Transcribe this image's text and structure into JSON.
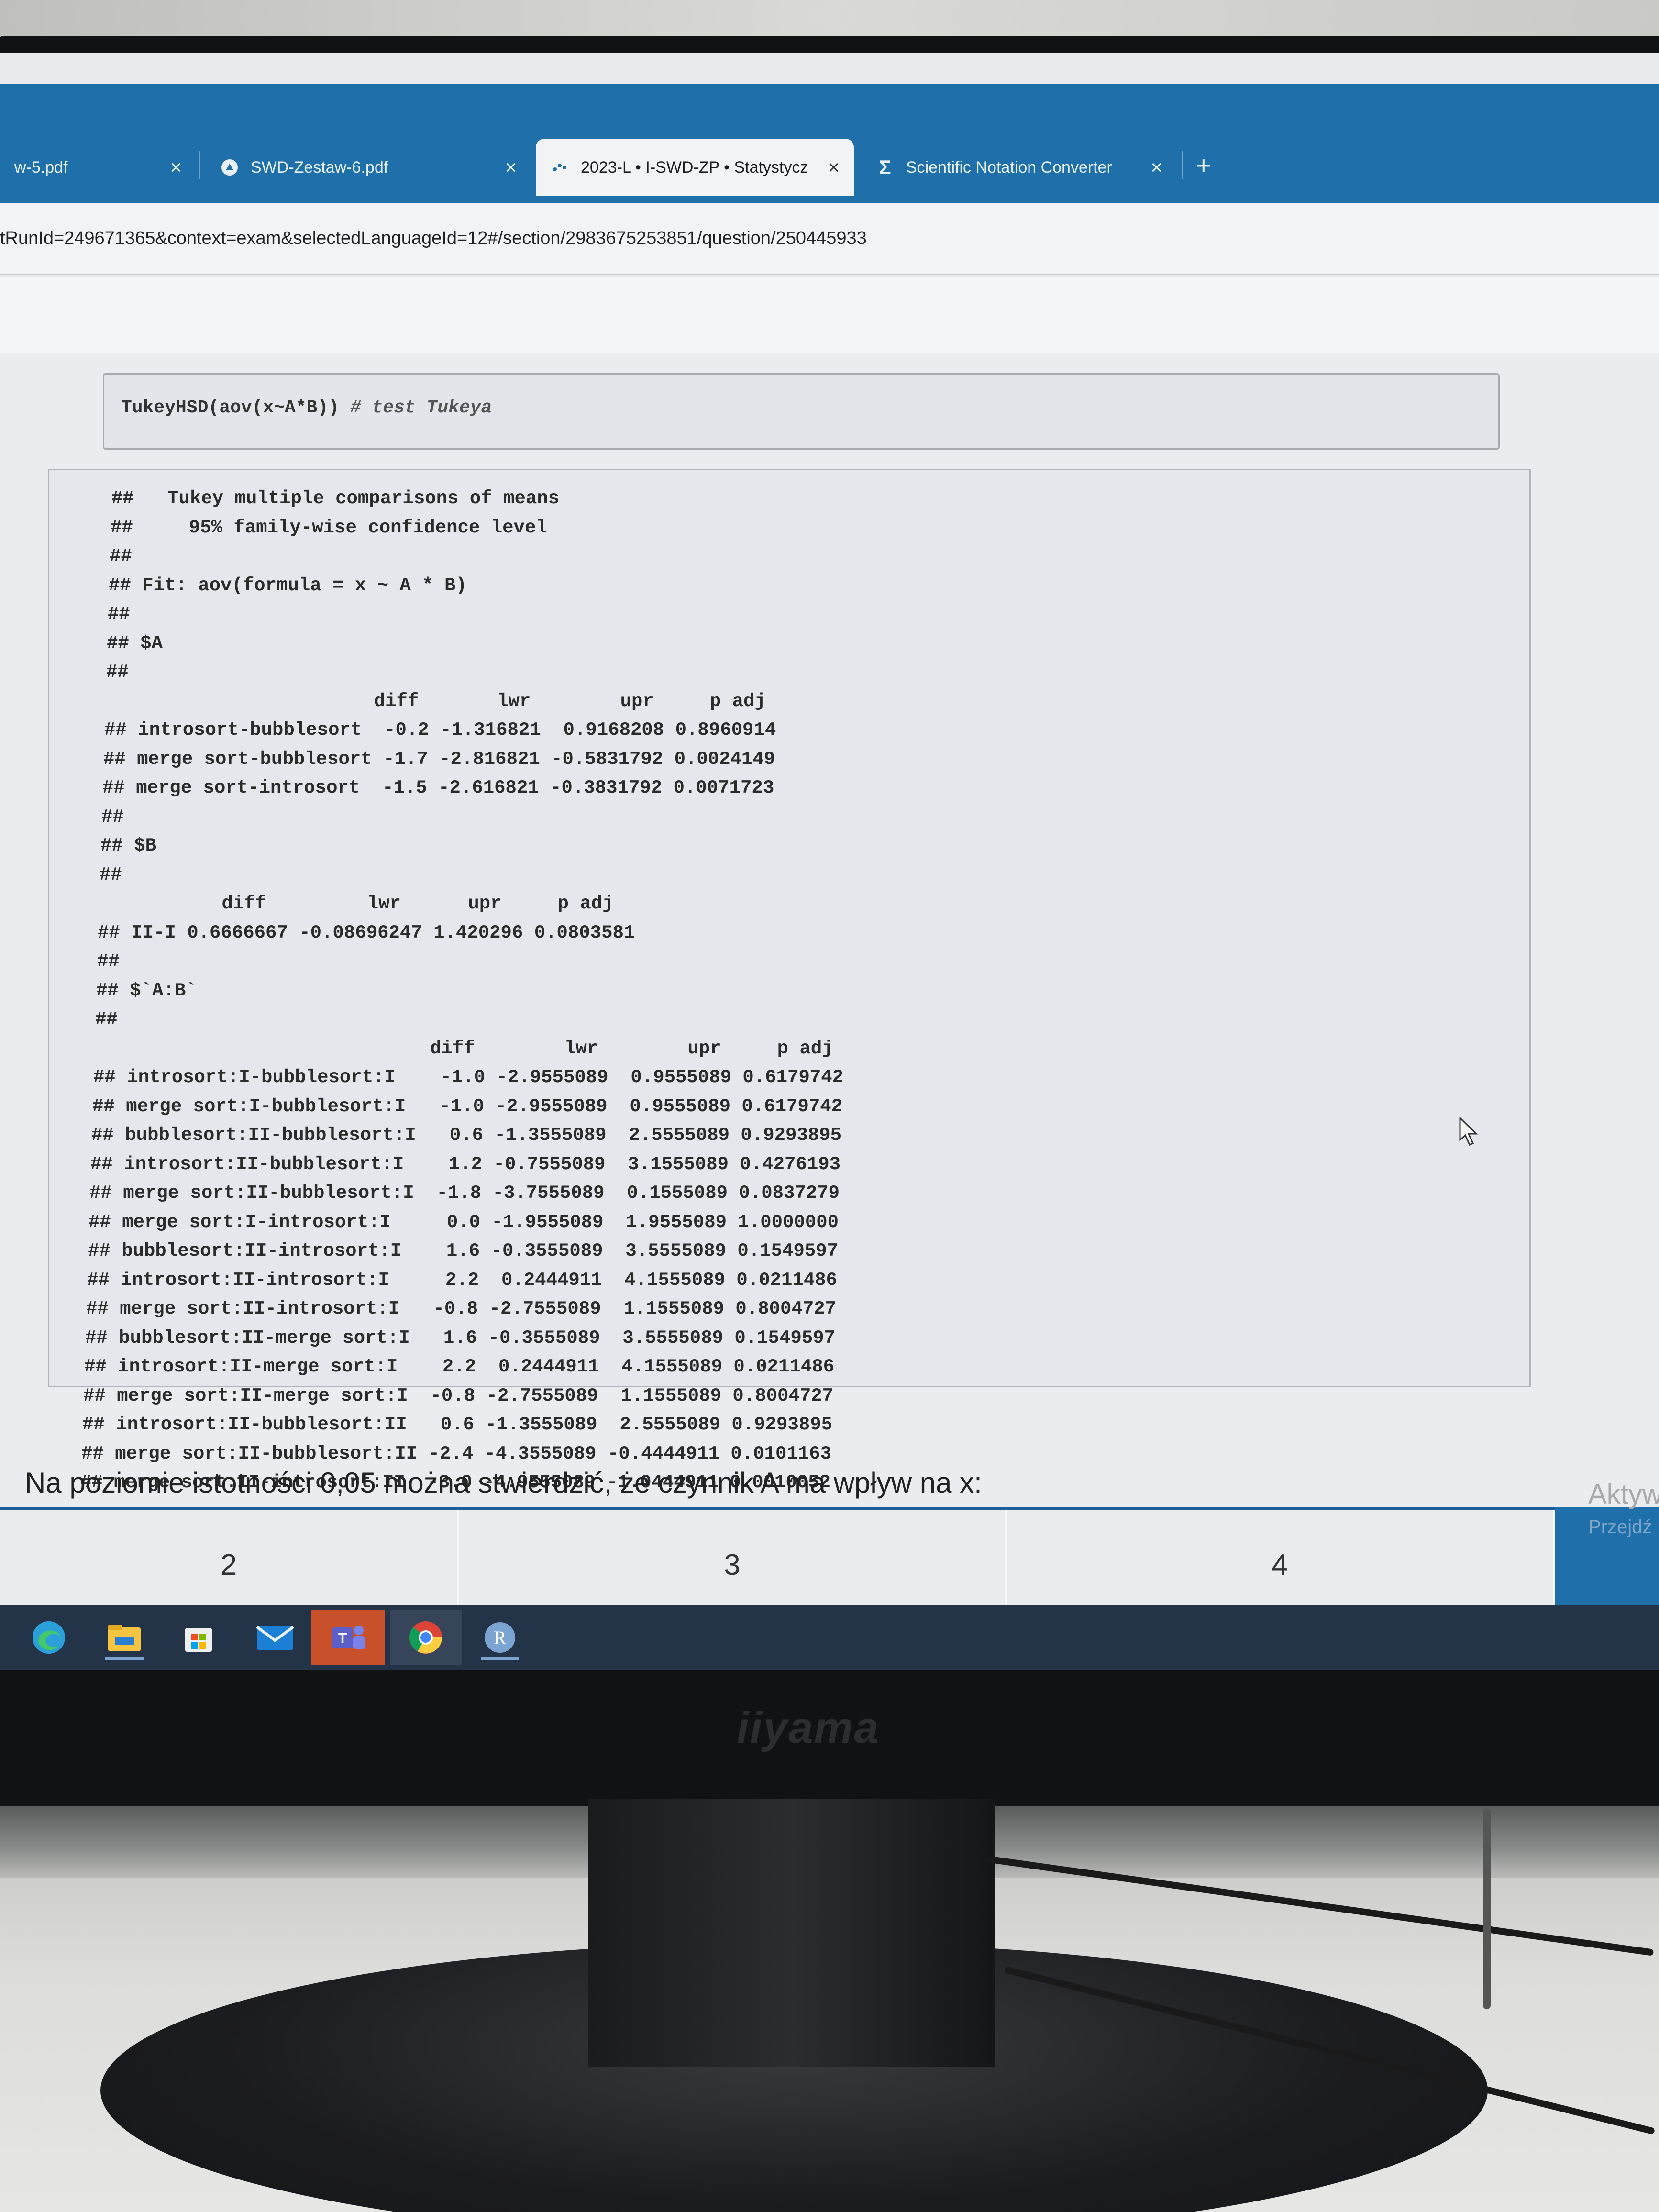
{
  "browser": {
    "tabs": [
      {
        "label": "w-5.pdf",
        "close": "×",
        "active": false
      },
      {
        "label": "SWD-Zestaw-6.pdf",
        "close": "×",
        "active": false
      },
      {
        "label": "2023-L • I-SWD-ZP • Statystycz",
        "close": "×",
        "active": true
      },
      {
        "label": "Scientific Notation Converter",
        "close": "×",
        "active": false
      }
    ],
    "new_tab": "+",
    "url": "tRunId=249671365&context=exam&selectedLanguageId=12#/section/2983675253851/question/250445933"
  },
  "code": {
    "command": "TukeyHSD(aov(x~A*B)) ",
    "comment": "# test Tukeya"
  },
  "output_lines": [
    "##   Tukey multiple comparisons of means",
    "##     95% family-wise confidence level",
    "##",
    "## Fit: aov(formula = x ~ A * B)",
    "##",
    "## $A",
    "##",
    "                        diff       lwr        upr     p adj",
    "## introsort-bubblesort  -0.2 -1.316821  0.9168208 0.8960914",
    "## merge sort-bubblesort -1.7 -2.816821 -0.5831792 0.0024149",
    "## merge sort-introsort  -1.5 -2.616821 -0.3831792 0.0071723",
    "##",
    "## $B",
    "##",
    "           diff         lwr      upr     p adj",
    "## II-I 0.6666667 -0.08696247 1.420296 0.0803581",
    "##",
    "## $`A:B`",
    "##",
    "                              diff        lwr        upr     p adj",
    "## introsort:I-bubblesort:I    -1.0 -2.9555089  0.9555089 0.6179742",
    "## merge sort:I-bubblesort:I   -1.0 -2.9555089  0.9555089 0.6179742",
    "## bubblesort:II-bubblesort:I   0.6 -1.3555089  2.5555089 0.9293895",
    "## introsort:II-bubblesort:I    1.2 -0.7555089  3.1555089 0.4276193",
    "## merge sort:II-bubblesort:I  -1.8 -3.7555089  0.1555089 0.0837279",
    "## merge sort:I-introsort:I     0.0 -1.9555089  1.9555089 1.0000000",
    "## bubblesort:II-introsort:I    1.6 -0.3555089  3.5555089 0.1549597",
    "## introsort:II-introsort:I     2.2  0.2444911  4.1555089 0.0211486",
    "## merge sort:II-introsort:I   -0.8 -2.7555089  1.1555089 0.8004727",
    "## bubblesort:II-merge sort:I   1.6 -0.3555089  3.5555089 0.1549597",
    "## introsort:II-merge sort:I    2.2  0.2444911  4.1555089 0.0211486",
    "## merge sort:II-merge sort:I  -0.8 -2.7555089  1.1555089 0.8004727",
    "## introsort:II-bubblesort:II   0.6 -1.3555089  2.5555089 0.9293895",
    "## merge sort:II-bubblesort:II -2.4 -4.3555089 -0.4444911 0.0101163",
    "## merge sort:II-introsort:II  -3.0 -4.9555089 -1.0444911 0.0010052"
  ],
  "question": "Na poziomie istotności 0,05 można stwierdzić, że czynnik A ma wpływ na x:",
  "answers": [
    "2",
    "3",
    "4"
  ],
  "activation": {
    "title": "Aktyw",
    "sub": "Przejdź"
  },
  "taskbar": [
    "edge-icon",
    "file-explorer-icon",
    "store-icon",
    "mail-icon",
    "teams-icon",
    "chrome-icon",
    "r-icon"
  ],
  "monitor_brand": "iiyama"
}
